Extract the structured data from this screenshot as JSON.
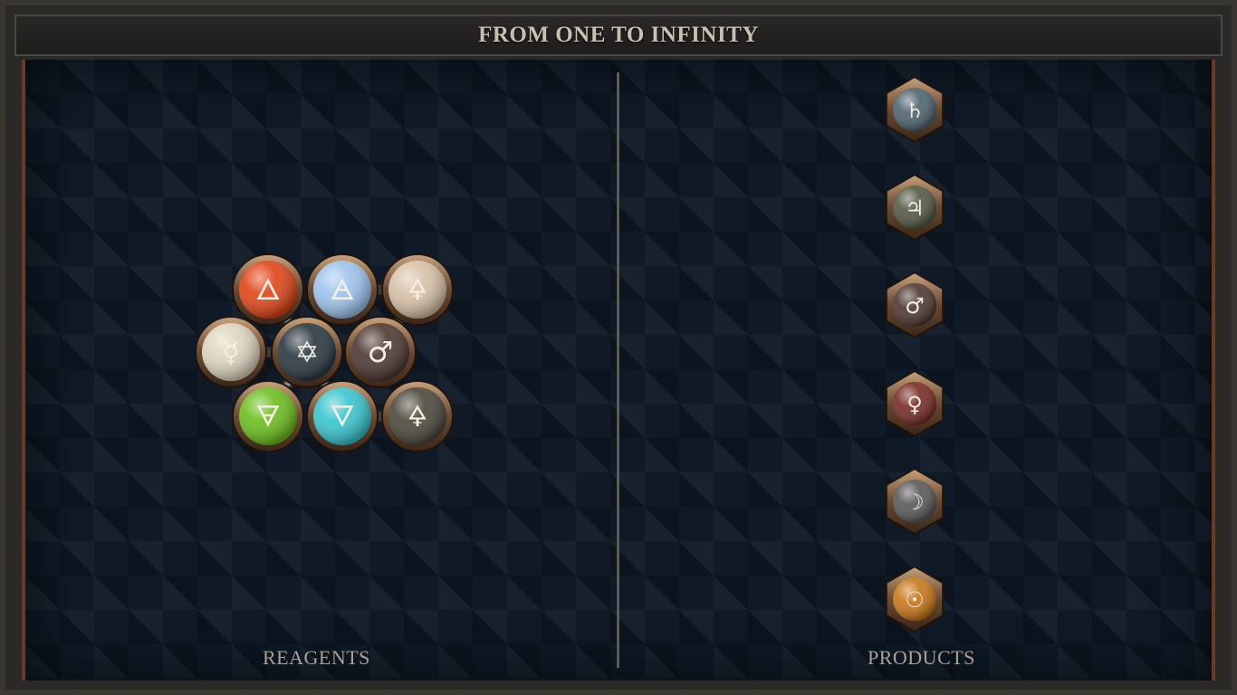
{
  "title": "FROM ONE TO INFINITY",
  "labels": {
    "reagents": "REAGENTS",
    "products": "PRODUCTS"
  },
  "reagents": [
    {
      "name": "fire",
      "symbol": "🜂",
      "color": "#e0471a"
    },
    {
      "name": "air",
      "symbol": "🜁",
      "color": "#9ec4ee"
    },
    {
      "name": "salt",
      "symbol": "🜍",
      "color": "#d8c2a8"
    },
    {
      "name": "quicksilver",
      "symbol": "☿",
      "color": "#ddd5bf"
    },
    {
      "name": "quintessence",
      "symbol": "✡",
      "color": "#2c3a44"
    },
    {
      "name": "iron",
      "symbol": "♂",
      "color": "#4f3a35"
    },
    {
      "name": "earth",
      "symbol": "🜃",
      "color": "#6dbf20"
    },
    {
      "name": "water",
      "symbol": "🜄",
      "color": "#3ac6cf"
    },
    {
      "name": "vitae",
      "symbol": "🜍",
      "color": "#4c4a3c"
    }
  ],
  "products": [
    {
      "name": "lead",
      "symbol": "♄",
      "color": "#4f6670"
    },
    {
      "name": "tin",
      "symbol": "♃",
      "color": "#565a45"
    },
    {
      "name": "iron",
      "symbol": "♂",
      "color": "#4f3a35"
    },
    {
      "name": "copper",
      "symbol": "♀",
      "color": "#7a2e28"
    },
    {
      "name": "silver",
      "symbol": "☽",
      "color": "#5a5a5a"
    },
    {
      "name": "gold",
      "symbol": "☉",
      "color": "#c8781a"
    }
  ]
}
